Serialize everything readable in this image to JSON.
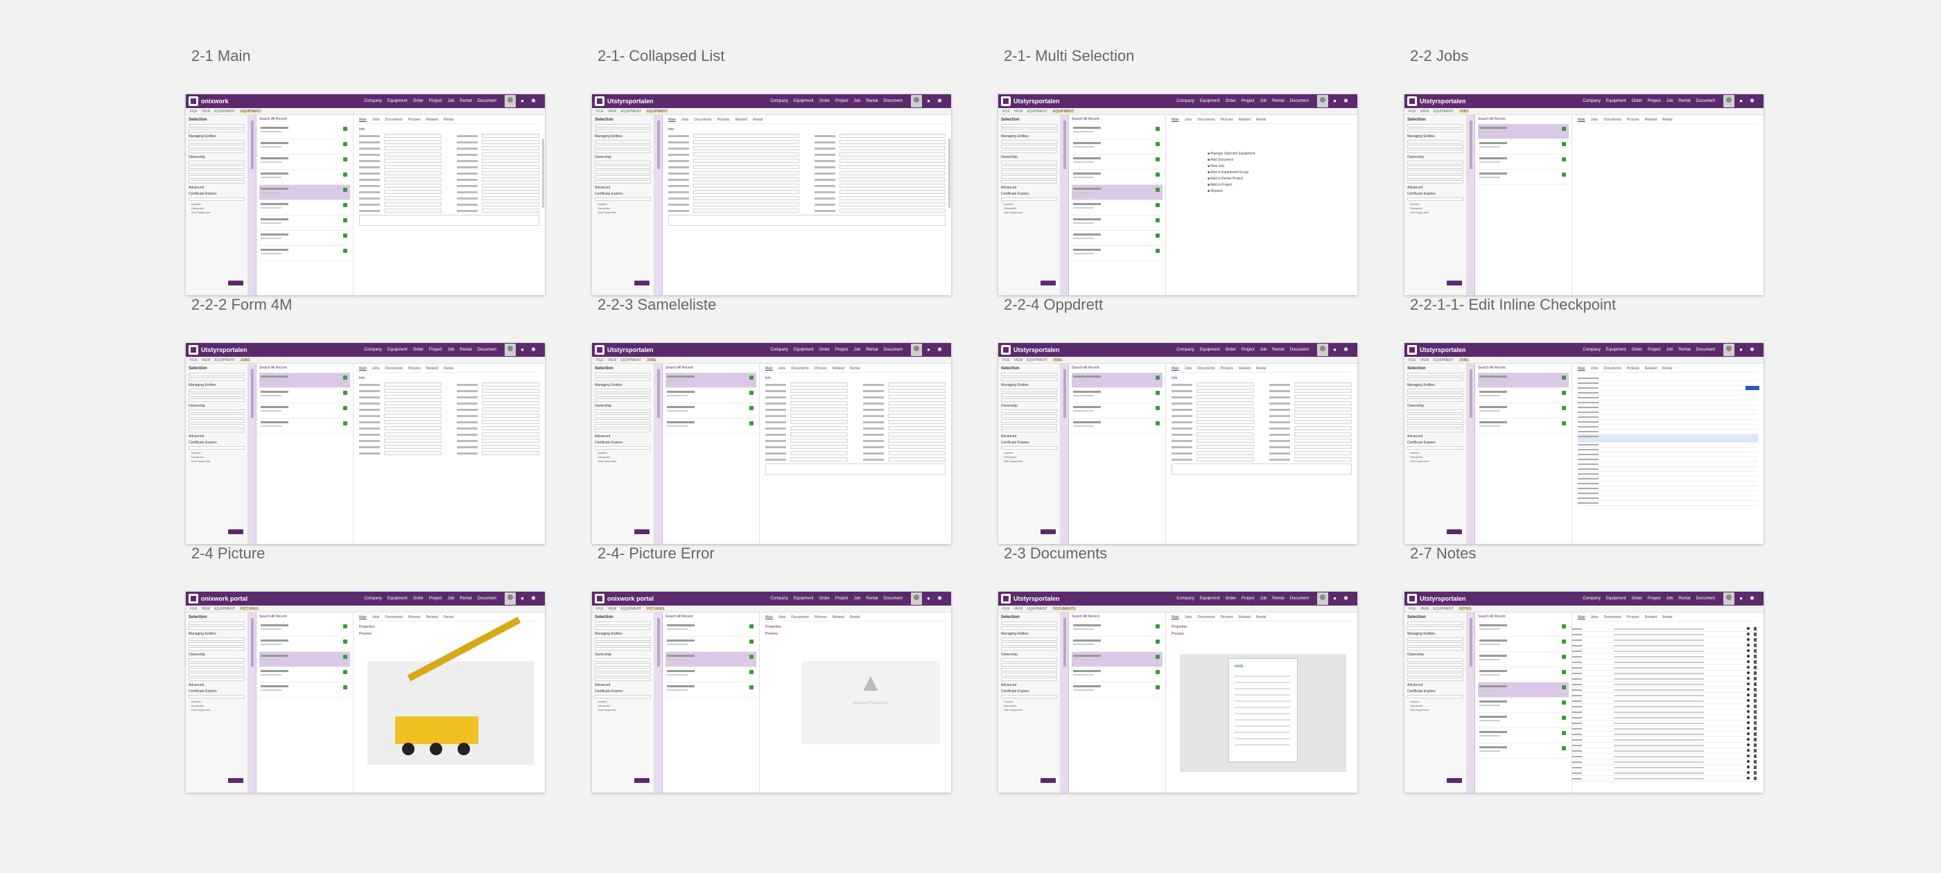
{
  "artboards": [
    {
      "id": "main",
      "label": "2-1 Main",
      "title": "onixwork",
      "variant": "main",
      "menu_active": "EQUIPMENT"
    },
    {
      "id": "collapsed",
      "label": "2-1- Collapsed List",
      "title": "Utstyrsportalen",
      "variant": "collapsed",
      "menu_active": "EQUIPMENT"
    },
    {
      "id": "multi",
      "label": "2-1- Multi Selection",
      "title": "Utstyrsportalen",
      "variant": "multi",
      "menu_active": "EQUIPMENT"
    },
    {
      "id": "jobs",
      "label": "2-2 Jobs",
      "title": "Utstyrsportalen",
      "variant": "jobs",
      "menu_active": "JOBS"
    },
    {
      "id": "form4m",
      "label": "2-2-2 Form 4M",
      "title": "Utstyrsportalen",
      "variant": "form",
      "menu_active": "JOBS"
    },
    {
      "id": "samle",
      "label": "2-2-3 Sameleliste",
      "title": "Utstyrsportalen",
      "variant": "samle",
      "menu_active": "JOBS"
    },
    {
      "id": "oppdrett",
      "label": "2-2-4 Oppdrett",
      "title": "Utstyrsportalen",
      "variant": "samle",
      "menu_active": "JOBS"
    },
    {
      "id": "checkpoint",
      "label": "2-2-1-1- Edit Inline Checkpoint",
      "title": "Utstyrsportalen",
      "variant": "checkpoint",
      "menu_active": "JOBS"
    },
    {
      "id": "picture",
      "label": "2-4 Picture",
      "title": "onixwork portal",
      "variant": "picture",
      "menu_active": "PICTURES"
    },
    {
      "id": "picerr",
      "label": "2-4- Picture Error",
      "title": "onixwork portal",
      "variant": "picerror",
      "menu_active": "PICTURES"
    },
    {
      "id": "documents",
      "label": "2-3 Documents",
      "title": "Utstyrsportalen",
      "variant": "documents",
      "menu_active": "DOCUMENTS"
    },
    {
      "id": "notes",
      "label": "2-7 Notes",
      "title": "Utstyrsportalen",
      "variant": "notes",
      "menu_active": "NOTES"
    }
  ],
  "top_nav": [
    "Company",
    "Equipment",
    "Order",
    "Project",
    "Job",
    "Rental",
    "Document"
  ],
  "menu_items": [
    "FILE",
    "VIEW",
    "EQUIPMENT"
  ],
  "sidebar": {
    "title": "Selection",
    "groups": [
      "Managing Entities",
      "Ownership",
      "Advanced",
      "Certificate Expires"
    ],
    "checks": [
      "Inactive",
      "Discarded",
      "Sub Equipment"
    ],
    "button": "Search"
  },
  "list_tabs": "Search All   Recent",
  "detail_tabs": [
    "Main",
    "Jobs",
    "Documents",
    "Pictures",
    "Related",
    "Rental"
  ],
  "sections": {
    "info": "Info",
    "properties": "Properties",
    "preview": "Preview",
    "properties2": "Properties"
  },
  "multi_menu": [
    "Manage Selected Equipment",
    "Add Document",
    "New Job",
    "Add to Equipment Group",
    "Add to Rental Project",
    "Add to Project",
    "Reports"
  ],
  "error_text": "Damaged Picture Error"
}
